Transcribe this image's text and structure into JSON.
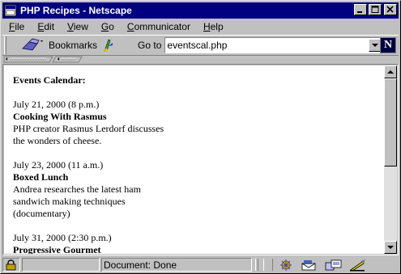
{
  "window": {
    "title": "PHP Recipes - Netscape"
  },
  "menu": [
    {
      "label": "File",
      "key": "F",
      "rest": "ile"
    },
    {
      "label": "Edit",
      "key": "E",
      "rest": "dit"
    },
    {
      "label": "View",
      "key": "V",
      "rest": "iew"
    },
    {
      "label": "Go",
      "key": "G",
      "rest": "o"
    },
    {
      "label": "Communicator",
      "key": "C",
      "rest": "ommunicator"
    },
    {
      "label": "Help",
      "key": "H",
      "rest": "elp"
    }
  ],
  "toolbar": {
    "bookmarks_label": "Bookmarks",
    "goto_label": "Go to",
    "url": "eventscal.php"
  },
  "page": {
    "heading": "Events Calendar:",
    "events": [
      {
        "date": "July 21, 2000 (8 p.m.)",
        "title": "Cooking With Rasmus",
        "description_lines": [
          "PHP creator Rasmus Lerdorf discusses",
          "the wonders of cheese."
        ]
      },
      {
        "date": "July 23, 2000 (11 a.m.)",
        "title": "Boxed Lunch",
        "description_lines": [
          "Andrea researches the latest ham",
          "sandwich making techniques",
          "(documentary)"
        ]
      },
      {
        "date": "July 31, 2000 (2:30 p.m.)",
        "title": "Progressive Gourmet",
        "description_lines": []
      }
    ]
  },
  "status": {
    "text": "Document: Done"
  },
  "colors": {
    "titlebar": "#000080",
    "chrome": "#c0c0c0"
  }
}
